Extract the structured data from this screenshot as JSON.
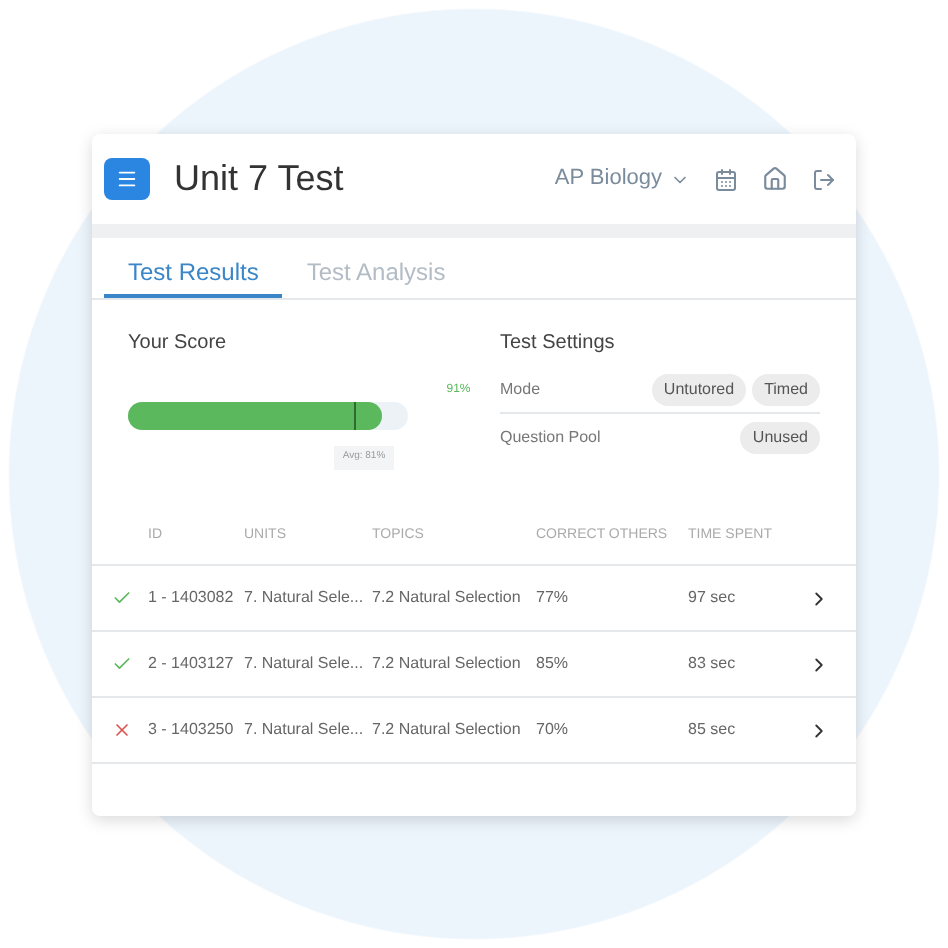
{
  "header": {
    "title": "Unit 7 Test",
    "course": "AP Biology"
  },
  "tabs": [
    {
      "label": "Test Results",
      "selected": true
    },
    {
      "label": "Test Analysis",
      "selected": false
    }
  ],
  "score": {
    "title": "Your Score",
    "level": 0.91,
    "reading": "91%",
    "average": "Avg: 81%"
  },
  "settings": {
    "title": "Test Settings",
    "rows": [
      {
        "label": "Mode",
        "tags": [
          "Untutored",
          "Timed"
        ]
      },
      {
        "label": "Question Pool",
        "tags": [
          "Unused"
        ]
      }
    ]
  },
  "table": {
    "columns": [
      "ID",
      "UNITS",
      "TOPICS",
      "CORRECT OTHERS",
      "TIME SPENT"
    ],
    "rows": [
      {
        "correct": true,
        "id": "1 - 1403082",
        "unit": "7. Natural Sele...",
        "topic": "7.2 Natural Selection",
        "correct_others": "77%",
        "time": "97 sec"
      },
      {
        "correct": true,
        "id": "2 - 1403127",
        "unit": "7. Natural Sele...",
        "topic": "7.2 Natural Selection",
        "correct_others": "85%",
        "time": "83 sec"
      },
      {
        "correct": false,
        "id": "3 - 1403250",
        "unit": "7. Natural Sele...",
        "topic": "7.2 Natural Selection",
        "correct_others": "70%",
        "time": "85 sec"
      }
    ]
  }
}
